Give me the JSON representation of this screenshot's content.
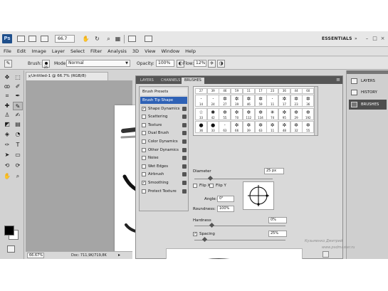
{
  "app_bar": {
    "logo": "Ps",
    "zoom": "66.7",
    "workspace": "ESSENTIALS",
    "window_buttons": [
      "–",
      "□",
      "×"
    ]
  },
  "menu": [
    "File",
    "Edit",
    "Image",
    "Layer",
    "Select",
    "Filter",
    "Analysis",
    "3D",
    "View",
    "Window",
    "Help"
  ],
  "options": {
    "brush_label": "Brush:",
    "brush_size": "25",
    "mode_label": "Mode:",
    "mode_value": "Normal",
    "opacity_label": "Opacity:",
    "opacity_value": "100%",
    "flow_label": "Flow:",
    "flow_value": "12%"
  },
  "document": {
    "tab_title": "Untitled-1 @ 66.7% (RGB/8)",
    "close_glyph": "×",
    "zoom_status": "66.67%",
    "doc_info": "Doc: 711,9K/719,8K",
    "status_arrow": "▸"
  },
  "toolbox": {
    "foreground": "#000000",
    "background": "#ffffff"
  },
  "panel": {
    "tabs": [
      "LAYERS",
      "CHANNELS",
      "BRUSHES"
    ],
    "active_tab": "BRUSHES",
    "menu_glyph": "≡",
    "presets_title": "Brush Presets",
    "settings": [
      {
        "label": "Brush Tip Shape",
        "selected": true,
        "checkable": false,
        "checked": false
      },
      {
        "label": "Shape Dynamics",
        "selected": false,
        "checkable": true,
        "checked": true
      },
      {
        "label": "Scattering",
        "selected": false,
        "checkable": true,
        "checked": false
      },
      {
        "label": "Texture",
        "selected": false,
        "checkable": true,
        "checked": false
      },
      {
        "label": "Dual Brush",
        "selected": false,
        "checkable": true,
        "checked": false
      },
      {
        "label": "Color Dynamics",
        "selected": false,
        "checkable": true,
        "checked": false
      },
      {
        "label": "Other Dynamics",
        "selected": false,
        "checkable": true,
        "checked": false
      },
      {
        "label": "Noise",
        "selected": false,
        "checkable": true,
        "checked": false
      },
      {
        "label": "Wet Edges",
        "selected": false,
        "checkable": true,
        "checked": false
      },
      {
        "label": "Airbrush",
        "selected": false,
        "checkable": true,
        "checked": false
      },
      {
        "label": "Smoothing",
        "selected": false,
        "checkable": true,
        "checked": true
      },
      {
        "label": "Protect Texture",
        "selected": false,
        "checkable": true,
        "checked": false
      }
    ],
    "tips_row1_numbers": [
      "27",
      "39",
      "46",
      "59",
      "11",
      "17",
      "23",
      "36",
      "44",
      "60"
    ],
    "tips": [
      {
        "glyph": "·",
        "num": "14"
      },
      {
        "glyph": "·",
        "num": "24"
      },
      {
        "glyph": "✲",
        "num": "27"
      },
      {
        "glyph": "✲",
        "num": "39"
      },
      {
        "glyph": "✲",
        "num": "46"
      },
      {
        "glyph": "✲",
        "num": "59"
      },
      {
        "glyph": "·",
        "num": "11"
      },
      {
        "glyph": "✲",
        "num": "17"
      },
      {
        "glyph": "✲",
        "num": "23"
      },
      {
        "glyph": "✲",
        "num": "36"
      },
      {
        "glyph": "☆",
        "num": "33"
      },
      {
        "glyph": "✱",
        "num": "42"
      },
      {
        "glyph": "✲",
        "num": "55"
      },
      {
        "glyph": "✲",
        "num": "70"
      },
      {
        "glyph": "✲",
        "num": "112"
      },
      {
        "glyph": "✲",
        "num": "134"
      },
      {
        "glyph": "✳",
        "num": "74"
      },
      {
        "glyph": "✲",
        "num": "95"
      },
      {
        "glyph": "✲",
        "num": "29"
      },
      {
        "glyph": "✲",
        "num": "192"
      },
      {
        "glyph": "●",
        "num": "36"
      },
      {
        "glyph": "●",
        "num": "33"
      },
      {
        "glyph": "·",
        "num": "63"
      },
      {
        "glyph": "✲",
        "num": "66"
      },
      {
        "glyph": "✲",
        "num": "39"
      },
      {
        "glyph": "✲",
        "num": "63"
      },
      {
        "glyph": "✲",
        "num": "11"
      },
      {
        "glyph": "✲",
        "num": "48"
      },
      {
        "glyph": "✲",
        "num": "32"
      },
      {
        "glyph": "✲",
        "num": "55"
      }
    ],
    "diameter_label": "Diameter",
    "diameter_value": "25 px",
    "flip_x": "Flip X",
    "flip_y": "Flip Y",
    "angle_label": "Angle:",
    "angle_value": "0°",
    "roundness_label": "Roundness:",
    "roundness_value": "100%",
    "hardness_label": "Hardness",
    "hardness_value": "0%",
    "spacing_label": "Spacing",
    "spacing_value": "25%",
    "spacing_checked": true,
    "check_glyph": "✓"
  },
  "dock": [
    "LAYERS",
    "HISTORY",
    "BRUSHES"
  ],
  "dock_active": "BRUSHES",
  "watermark": {
    "line1": "Кузьменко Дмитрий",
    "line2": "www.psdmaster.ru"
  }
}
